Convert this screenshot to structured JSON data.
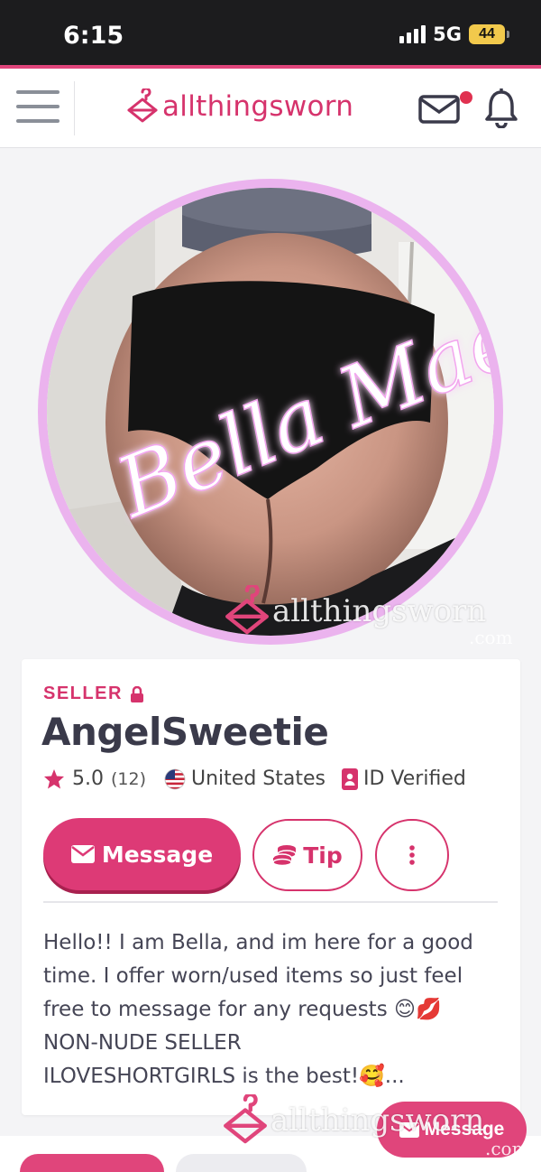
{
  "status_bar": {
    "time": "6:15",
    "network": "5G",
    "battery": "44"
  },
  "header": {
    "logo_text": "allthingsworn",
    "menu_icon": "hamburger-icon",
    "mail_icon": "mail-icon",
    "bell_icon": "bell-icon"
  },
  "profile_image": {
    "overlay_text": "Bella Mae",
    "watermark_text": "allthingsworn",
    "watermark_suffix": ".com"
  },
  "profile": {
    "role": "SELLER",
    "username": "AngelSweetie",
    "rating": "5.0",
    "review_count": "(12)",
    "country": "United States",
    "verification": "ID Verified"
  },
  "actions": {
    "message_label": "Message",
    "tip_label": "Tip",
    "more_icon": "more-vertical-icon"
  },
  "bio": {
    "lines": [
      "Hello!! I am Bella, and im here for a good",
      "time. I offer worn/used items so just feel",
      "free to message for any requests 😊💋",
      "NON-NUDE SELLER",
      "ILOVESHORTGIRLS is the best!🥰..."
    ]
  },
  "floating": {
    "message_label": "Message",
    "watermark_text": "allthingsworn",
    "watermark_suffix": ".com"
  },
  "colors": {
    "brand": "#d6336c",
    "button": "#dd3a76",
    "ring": "#ebb3ee",
    "text": "#3a3a4a"
  }
}
